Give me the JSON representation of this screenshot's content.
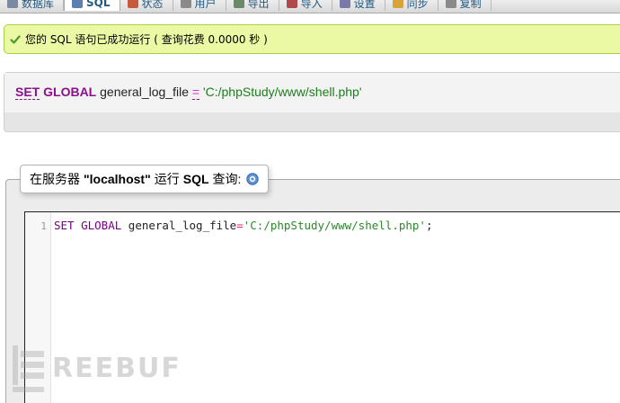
{
  "tabs": [
    {
      "label": "数据库",
      "icon": "database-icon",
      "color": "#7a8aa0",
      "active": false
    },
    {
      "label": "SQL",
      "icon": "sql-icon",
      "color": "#5b7fb0",
      "active": true
    },
    {
      "label": "状态",
      "icon": "status-icon",
      "color": "#c65a3a",
      "active": false
    },
    {
      "label": "用户",
      "icon": "users-icon",
      "color": "#8a8a8a",
      "active": false
    },
    {
      "label": "导出",
      "icon": "export-icon",
      "color": "#6a8a6a",
      "active": false
    },
    {
      "label": "导入",
      "icon": "import-icon",
      "color": "#b04a4a",
      "active": false
    },
    {
      "label": "设置",
      "icon": "settings-icon",
      "color": "#7a7aa8",
      "active": false
    },
    {
      "label": "同步",
      "icon": "sync-icon",
      "color": "#d9a23a",
      "active": false
    },
    {
      "label": "复制",
      "icon": "replication-icon",
      "color": "#8a8a8a",
      "active": false
    }
  ],
  "success": {
    "message": "您的 SQL 语句已成功运行 ( 查询花费 0.0000 秒 )",
    "icon": "check-icon",
    "color": "#4c9a2a"
  },
  "sql_result": {
    "kw_set": "SET",
    "kw_global": "GLOBAL",
    "variable": "general_log_file",
    "operator": "=",
    "value": "'C:/phpStudy/www/shell.php'"
  },
  "query_box": {
    "prefix": "在服务器",
    "server": "\"localhost\"",
    "middle": "运行",
    "sql": "SQL",
    "suffix": "查询:",
    "help_icon": "help-icon"
  },
  "editor": {
    "line_number": "1",
    "kw_set": "SET",
    "kw_global": "GLOBAL",
    "variable": "general_log_file",
    "operator": "=",
    "value": "'C:/phpStudy/www/shell.php'",
    "terminator": ";"
  },
  "watermark": {
    "text": "REEBUF"
  }
}
